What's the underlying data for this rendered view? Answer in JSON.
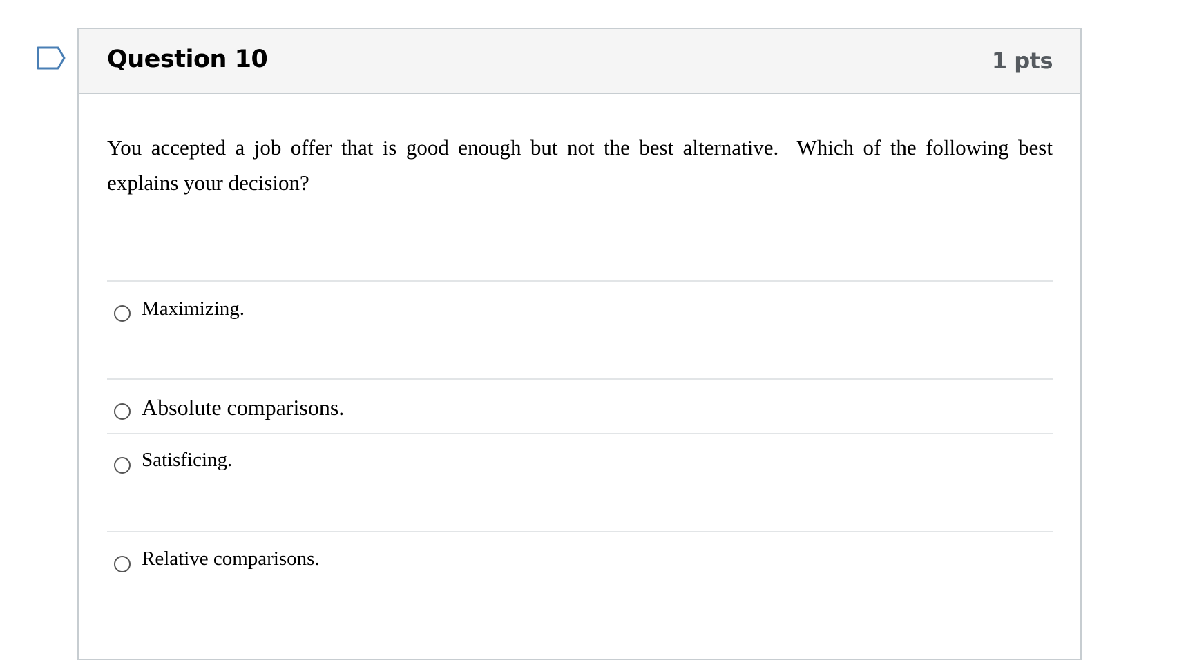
{
  "question": {
    "title": "Question 10",
    "points": "1 pts",
    "text": "You accepted a job offer that is good enough but not the best alternative.  Which of the following best explains your decision?",
    "flag_icon": "bookmark-flag-icon"
  },
  "answers": [
    {
      "label": "Maximizing."
    },
    {
      "label": "Absolute comparisons."
    },
    {
      "label": "Satisficing."
    },
    {
      "label": "Relative comparisons."
    }
  ],
  "colors": {
    "flag": "#4a7fb5",
    "header_bg": "#f5f5f5",
    "border": "#c7cdd1",
    "divider": "#e2e5e7",
    "points_text": "#555a5f"
  }
}
